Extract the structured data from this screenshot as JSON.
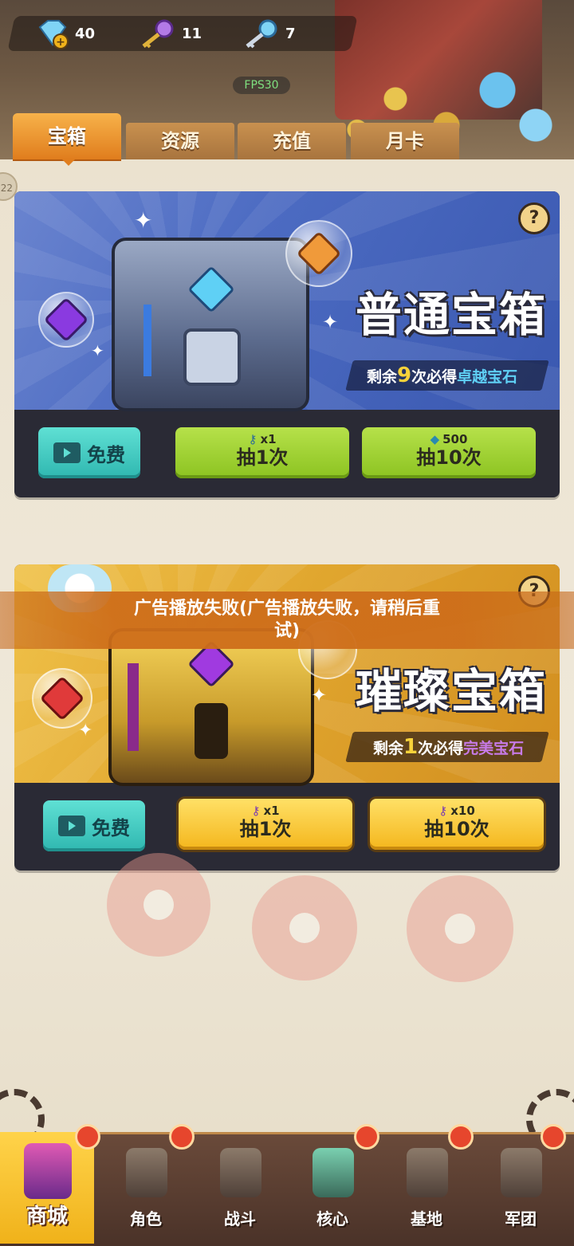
{
  "resources": [
    {
      "icon": "diamond-icon",
      "value": "40"
    },
    {
      "icon": "purple-key-icon",
      "value": "11"
    },
    {
      "icon": "blue-key-icon",
      "value": "7"
    }
  ],
  "fps": "FPS30",
  "tabs": [
    "宝箱",
    "资源",
    "充值",
    "月卡"
  ],
  "side_badge": "22",
  "normal_chest": {
    "title": "普通宝箱",
    "remain_prefix": "剩余",
    "remain_count": "9",
    "remain_mid": "次必得",
    "remain_reward": "卓越宝石",
    "free_label": "免费",
    "draw1": {
      "cost": "x1",
      "label": "抽1次"
    },
    "draw10": {
      "cost": "500",
      "label": "抽10次"
    }
  },
  "gold_chest": {
    "title": "璀璨宝箱",
    "remain_prefix": "剩余",
    "remain_count": "1",
    "remain_mid": "次必得",
    "remain_reward": "完美宝石",
    "free_label": "免费",
    "draw1": {
      "cost": "x1",
      "label": "抽1次"
    },
    "draw10": {
      "cost": "x10",
      "label": "抽10次"
    }
  },
  "toast": {
    "line1": "广告播放失败(广告播放失败，请稍后重",
    "line2": "试)"
  },
  "help_label": "?",
  "nav": [
    "商城",
    "角色",
    "战斗",
    "核心",
    "基地",
    "军团"
  ],
  "colors": {
    "accent_orange": "#e07d1d",
    "green_btn": "#8cc321",
    "yellow_btn": "#f4b61c",
    "teal_btn": "#2fb7b0"
  }
}
